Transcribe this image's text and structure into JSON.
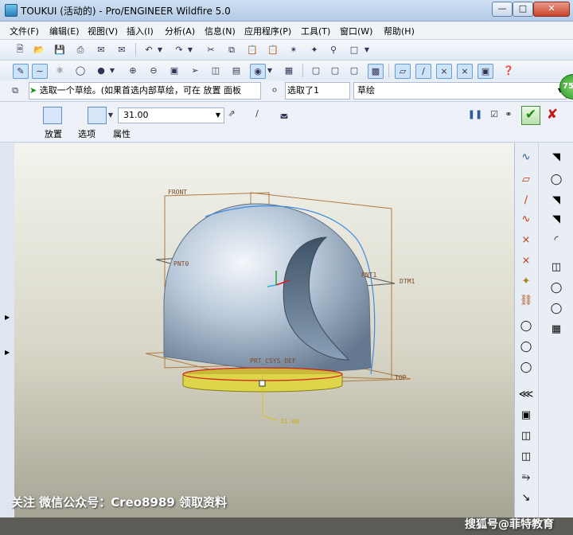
{
  "title": "TOUKUI (活动的) - Pro/ENGINEER Wildfire 5.0",
  "menu": [
    "文件(F)",
    "编辑(E)",
    "视图(V)",
    "插入(I)",
    "分析(A)",
    "信息(N)",
    "应用程序(P)",
    "工具(T)",
    "窗口(W)",
    "帮助(H)"
  ],
  "message": "选取一个草绘。(如果首选内部草绘，可在 放置 面板",
  "selection_status": "选取了1",
  "filter": "草绘",
  "help_bubble": "75",
  "dashboard": {
    "depth_value": "31.00",
    "tabs": [
      "放置",
      "选项",
      "属性"
    ]
  },
  "model_labels": {
    "front": "FRONT",
    "top": "TOP",
    "dtm1": "DTM1",
    "pnt0": "PNT0",
    "pnt1": "PNT1",
    "csys": "PRT_CSYS_DEF",
    "dim": "31.00"
  },
  "watermark_left": "关注 微信公众号：Creo8989 领取资料",
  "watermark_right": "搜狐号@菲特教育",
  "colors": {
    "accent": "#2a7fb8",
    "ok": "#1d8a14",
    "cancel": "#c41818",
    "helmet": "#a9bdd2",
    "datum": "#b07a45"
  }
}
